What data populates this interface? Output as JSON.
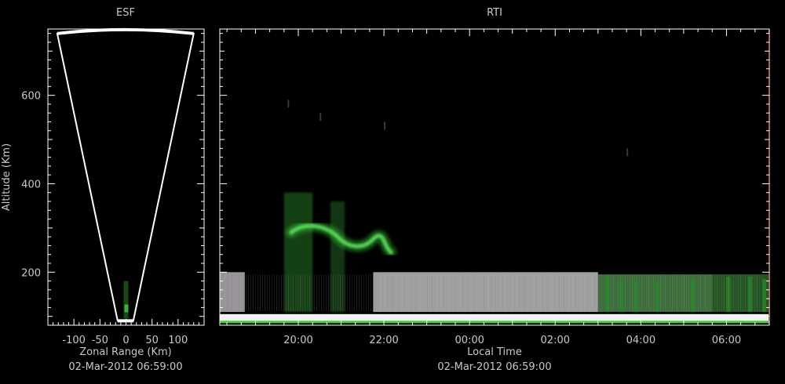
{
  "chart_data": [
    {
      "type": "heatmap",
      "title": "ESF",
      "xlabel": "Zonal Range (Km)",
      "ylabel": "Altitude (Km)",
      "date_label": "02-Mar-2012 06:59:00",
      "xlim": [
        -150,
        150
      ],
      "ylim": [
        80,
        750
      ],
      "x_ticks": [
        -100,
        -50,
        0,
        50,
        100
      ],
      "x_tick_labels": [
        "-100",
        "-50",
        "0",
        "50",
        "100"
      ],
      "y_ticks": [
        200,
        400,
        600
      ],
      "y_tick_labels": [
        "200",
        "400",
        "600"
      ],
      "fan_outline": {
        "apex_altitude": 90,
        "top_altitude": 745,
        "left_edge_top_range": -132,
        "right_edge_top_range": 130,
        "left_edge_bottom_range": -16,
        "right_edge_bottom_range": 14
      },
      "echoes": [
        {
          "x": 0,
          "y0": 95,
          "y1": 180,
          "intensity": "faint-green"
        }
      ]
    },
    {
      "type": "heatmap",
      "title": "RTI",
      "xlabel": "Local Time",
      "date_label": "02-Mar-2012 06:59:00",
      "xlim": [
        "18:10",
        "07:00"
      ],
      "ylim": [
        80,
        750
      ],
      "x_tick_labels": [
        "20:00",
        "22:00",
        "00:00",
        "02:00",
        "04:00",
        "06:00"
      ],
      "y_ticks": [
        200,
        400,
        600
      ],
      "features": [
        {
          "name": "bottom-band",
          "t_start": "18:10",
          "t_end": "07:00",
          "alt_bottom": 88,
          "alt_top": 105,
          "color": "#f0f0f0"
        },
        {
          "name": "bottomside-layer",
          "t_start": "18:10",
          "t_end": "18:45",
          "alt_bottom": 110,
          "alt_top": 200,
          "color": "#bfb8c0"
        },
        {
          "name": "bottomside-layer",
          "t_start": "21:45",
          "t_end": "03:00",
          "alt_bottom": 110,
          "alt_top": 200,
          "color": "#c8c8c8"
        },
        {
          "name": "bottomside-layer",
          "t_start": "03:00",
          "t_end": "05:40",
          "alt_bottom": 110,
          "alt_top": 195,
          "color": "#4a8a4a"
        },
        {
          "name": "bottomside-layer",
          "t_start": "05:40",
          "t_end": "07:00",
          "alt_bottom": 110,
          "alt_top": 195,
          "color": "#2a6a2a"
        },
        {
          "name": "plume",
          "t_start": "19:40",
          "t_end": "20:20",
          "alt_bottom": 110,
          "alt_top": 380,
          "color": "#2f8f2f"
        },
        {
          "name": "plume",
          "t_start": "20:45",
          "t_end": "21:05",
          "alt_bottom": 110,
          "alt_top": 360,
          "color": "#2a7a2a"
        }
      ]
    }
  ],
  "colors": {
    "background": "#000000",
    "axis": "#ffffff",
    "text": "#c8c8c8",
    "echo_green": "#39d339"
  }
}
